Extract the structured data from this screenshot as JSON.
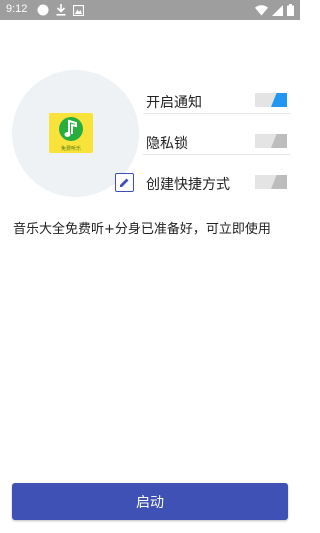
{
  "status_bar": {
    "time": "9:12",
    "icons": [
      "circle-icon",
      "download-icon",
      "image-icon",
      "wifi-icon",
      "signal-icon",
      "battery-icon"
    ]
  },
  "app": {
    "icon_label": "免费听乐",
    "icon_color": "#f9e33a",
    "note_color": "#27ae3f"
  },
  "settings": [
    {
      "label": "开启通知",
      "enabled": true
    },
    {
      "label": "隐私锁",
      "enabled": false
    },
    {
      "label": "创建快捷方式",
      "enabled": false
    }
  ],
  "description": "音乐大全免费听+分身已准备好，可立即使用",
  "launch_button": {
    "label": "启动"
  },
  "colors": {
    "accent": "#3f51b5",
    "toggle_on": "#2196f3",
    "toggle_off": "#bdbdbd",
    "status_bar": "#9e9e9e"
  }
}
